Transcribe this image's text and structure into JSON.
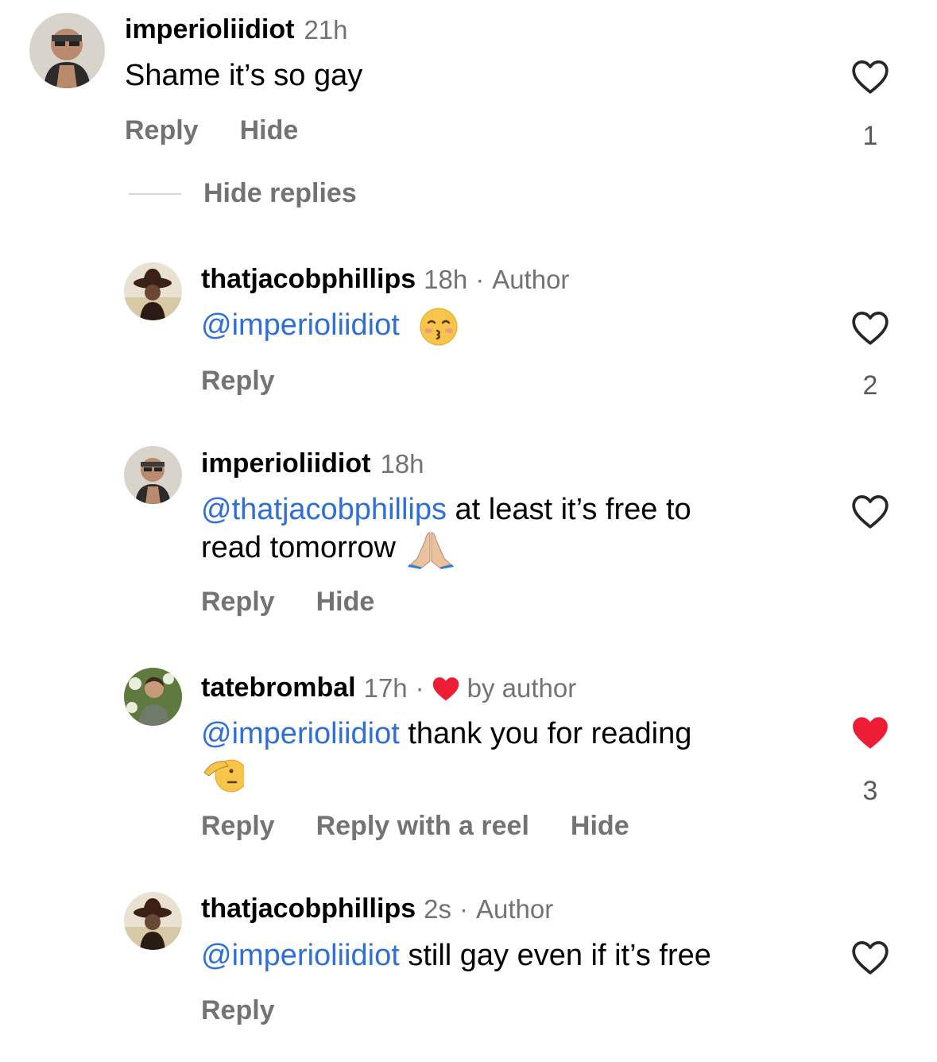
{
  "comments": [
    {
      "username": "imperioliidiot",
      "time": "21h",
      "text": "Shame it’s so gay",
      "actions": [
        "Reply",
        "Hide"
      ],
      "likes": "1",
      "liked": false,
      "avatar": "imperioliidiot-avatar"
    },
    {
      "username": "thatjacobphillips",
      "time": "18h",
      "meta_sep": "·",
      "badge": "Author",
      "mention": "@imperioliidiot",
      "text": "",
      "emoji": "kissing-face-emoji",
      "actions": [
        "Reply"
      ],
      "likes": "2",
      "liked": false,
      "avatar": "thatjacobphillips-avatar"
    },
    {
      "username": "imperioliidiot",
      "time": "18h",
      "mention": "@thatjacobphillips",
      "text_line1": " at least it’s free to",
      "text_line2": "read tomorrow ",
      "emoji": "folded-hands-emoji",
      "actions": [
        "Reply",
        "Hide"
      ],
      "likes": "",
      "liked": false,
      "avatar": "imperioliidiot-avatar"
    },
    {
      "username": "tatebrombal",
      "time": "17h",
      "meta_sep": "·",
      "badge": "by author",
      "badge_icon": "red-heart-icon",
      "mention": "@imperioliidiot",
      "text": " thank you for reading",
      "emoji": "saluting-face-emoji",
      "actions": [
        "Reply",
        "Reply with a reel",
        "Hide"
      ],
      "likes": "3",
      "liked": true,
      "avatar": "tatebrombal-avatar"
    },
    {
      "username": "thatjacobphillips",
      "time": "2s",
      "meta_sep": "·",
      "badge": "Author",
      "mention": "@imperioliidiot",
      "text": " still gay even if it’s free",
      "actions": [
        "Reply"
      ],
      "likes": "",
      "liked": false,
      "avatar": "thatjacobphillips-avatar"
    }
  ],
  "hide_replies_label": "Hide replies",
  "colors": {
    "mention": "#2e6fd8",
    "muted": "#737373",
    "liked_heart": "#ee1d36"
  }
}
